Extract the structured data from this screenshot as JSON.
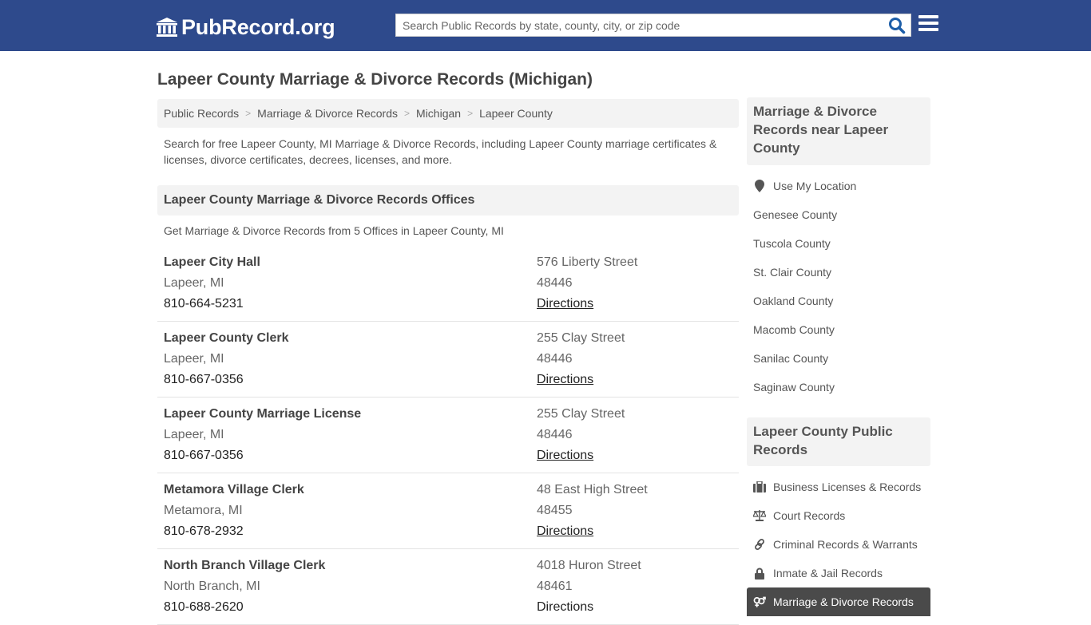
{
  "header": {
    "logo_text": "PubRecord.org",
    "search_placeholder": "Search Public Records by state, county, city, or zip code",
    "search_icon": "search-icon",
    "menu_icon": "hamburger-menu-icon"
  },
  "page_title": "Lapeer County Marriage & Divorce Records (Michigan)",
  "breadcrumb": [
    {
      "label": "Public Records"
    },
    {
      "label": "Marriage & Divorce Records"
    },
    {
      "label": "Michigan"
    },
    {
      "label": "Lapeer County"
    }
  ],
  "breadcrumb_separator": ">",
  "intro": "Search for free Lapeer County, MI Marriage & Divorce Records, including Lapeer County marriage certificates & licenses, divorce certificates, decrees, licenses, and more.",
  "offices_section": {
    "title": "Lapeer County Marriage & Divorce Records Offices",
    "count_text": "Get Marriage & Divorce Records from 5 Offices in Lapeer County, MI",
    "offices": [
      {
        "name": "Lapeer City Hall",
        "city": "Lapeer, MI",
        "phone": "810-664-5231",
        "street": "576 Liberty Street",
        "zip": "48446",
        "directions": "Directions"
      },
      {
        "name": "Lapeer County Clerk",
        "city": "Lapeer, MI",
        "phone": "810-667-0356",
        "street": "255 Clay Street",
        "zip": "48446",
        "directions": "Directions"
      },
      {
        "name": "Lapeer County Marriage License",
        "city": "Lapeer, MI",
        "phone": "810-667-0356",
        "street": "255 Clay Street",
        "zip": "48446",
        "directions": "Directions"
      },
      {
        "name": "Metamora Village Clerk",
        "city": "Metamora, MI",
        "phone": "810-678-2932",
        "street": "48 East High Street",
        "zip": "48455",
        "directions": "Directions"
      },
      {
        "name": "North Branch Village Clerk",
        "city": "North Branch, MI",
        "phone": "810-688-2620",
        "street": "4018 Huron Street",
        "zip": "48461",
        "directions": "Directions"
      }
    ]
  },
  "sidebar": {
    "nearby_title": "Marriage & Divorce Records near Lapeer County",
    "use_location": {
      "label": "Use My Location",
      "icon": "map-marker-icon"
    },
    "nearby": [
      {
        "label": "Genesee County"
      },
      {
        "label": "Tuscola County"
      },
      {
        "label": "St. Clair County"
      },
      {
        "label": "Oakland County"
      },
      {
        "label": "Macomb County"
      },
      {
        "label": "Sanilac County"
      },
      {
        "label": "Saginaw County"
      }
    ],
    "public_records_title": "Lapeer County Public Records",
    "public_records": [
      {
        "label": "Business Licenses & Records",
        "icon": "briefcase-icon"
      },
      {
        "label": "Court Records",
        "icon": "scales-icon"
      },
      {
        "label": "Criminal Records & Warrants",
        "icon": "link-icon"
      },
      {
        "label": "Inmate & Jail Records",
        "icon": "lock-icon"
      },
      {
        "label": "Marriage & Divorce Records",
        "icon": "venus-mars-icon",
        "active": true
      }
    ]
  },
  "colors": {
    "brand": "#2e4a8c",
    "search_icon": "#1d5ea8",
    "active_bg": "#4a4a4a"
  }
}
